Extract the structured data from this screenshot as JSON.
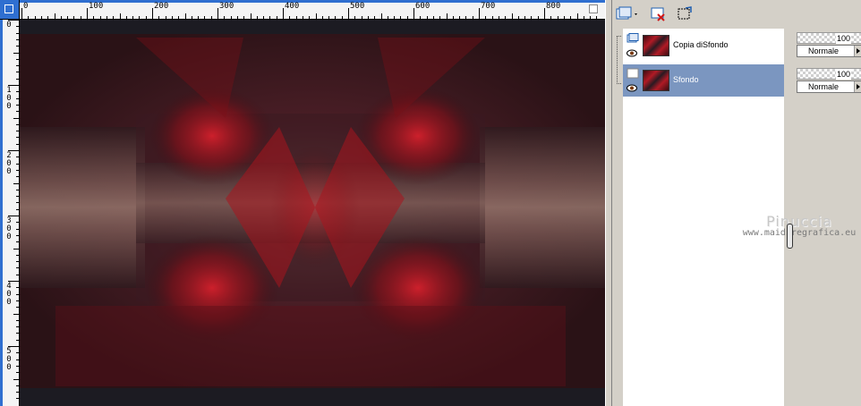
{
  "rulers": {
    "top_labels": [
      "0",
      "100",
      "200",
      "300",
      "400",
      "500",
      "600",
      "700",
      "800"
    ],
    "left_labels": [
      "0",
      "1\n0\n0",
      "2\n0\n0",
      "3\n0\n0",
      "4\n0\n0",
      "5\n0\n0"
    ]
  },
  "toolbar": {
    "new_layer_icon": "new-raster-layer-icon",
    "delete_icon": "delete-layer-icon",
    "mask_icon": "new-mask-icon"
  },
  "layers": [
    {
      "name": "Copia diSfondo",
      "opacity": "100",
      "blend": "Normale",
      "selected": false
    },
    {
      "name": "Sfondo",
      "opacity": "100",
      "blend": "Normale",
      "selected": true
    }
  ],
  "watermark": {
    "name": "Pinuccia",
    "url": "www.maidiregrafica.eu"
  },
  "colors": {
    "selection": "#7b96c0",
    "ruler_accent": "#2f6fd0",
    "art_red": "#b01a25",
    "art_dark": "#1e1d24"
  }
}
